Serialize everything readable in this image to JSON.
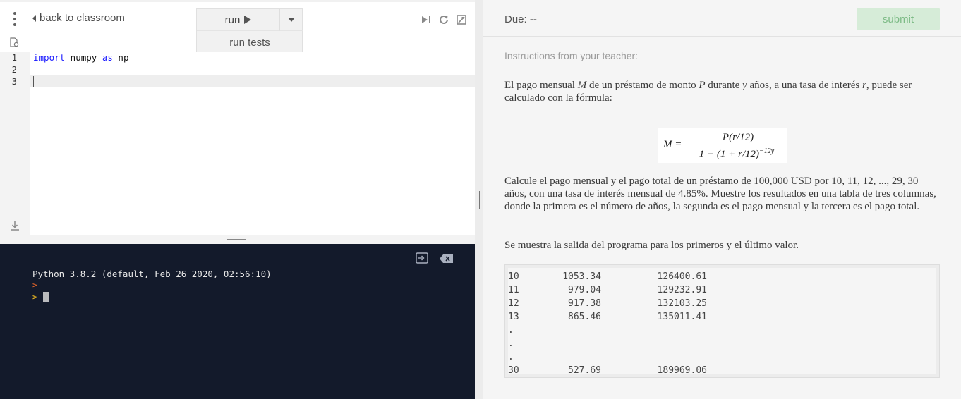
{
  "toolbar": {
    "back_label": "back to classroom",
    "run_label": "run",
    "run_tests_label": "run tests"
  },
  "editor": {
    "line_numbers": [
      "1",
      "2",
      "3"
    ],
    "code": {
      "kw1": "import",
      "mod": " numpy ",
      "kw2": "as",
      "alias": " np"
    }
  },
  "console": {
    "banner": "Python 3.8.2 (default, Feb 26 2020, 02:56:10)",
    "prompt_1": ">",
    "prompt_2": ">"
  },
  "right": {
    "due": "Due: --",
    "submit_label": "submit",
    "instructions_label": "Instructions from your teacher:",
    "para1": {
      "t1": "El pago mensual ",
      "v1": "M",
      "t2": " de un préstamo de monto ",
      "v2": "P",
      "t3": " durante ",
      "v3": "y",
      "t4": " años, a una tasa de interés ",
      "v4": "r",
      "t5": ", puede ser calculado con la fórmula:"
    },
    "formula": {
      "lhs": "M =",
      "numerator": "P(r/12)",
      "denominator": "1 − (1 + r/12)",
      "exponent": "−12y"
    },
    "para2": "Calcule el pago mensual y el pago total de un préstamo de 100,000 USD por 10, 11, 12, ..., 29, 30 años, con una tasa de interés mensual de 4.85%. Muestre los resultados en una tabla de tres columnas, donde la primera es el número de años, la segunda es el pago mensual y la tercera es el pago total.",
    "para3": "Se muestra la salida del programa para los primeros y el último valor.",
    "output_rows": [
      {
        "years": "10",
        "monthly": "1053.34",
        "total": "126400.61"
      },
      {
        "years": "11",
        "monthly": "979.04",
        "total": "129232.91"
      },
      {
        "years": "12",
        "monthly": "917.38",
        "total": "132103.25"
      },
      {
        "years": "13",
        "monthly": "865.46",
        "total": "135011.41"
      },
      {
        "years": ".",
        "monthly": "",
        "total": ""
      },
      {
        "years": ".",
        "monthly": "",
        "total": ""
      },
      {
        "years": ".",
        "monthly": "",
        "total": ""
      },
      {
        "years": "30",
        "monthly": "527.69",
        "total": "189969.06"
      }
    ]
  }
}
